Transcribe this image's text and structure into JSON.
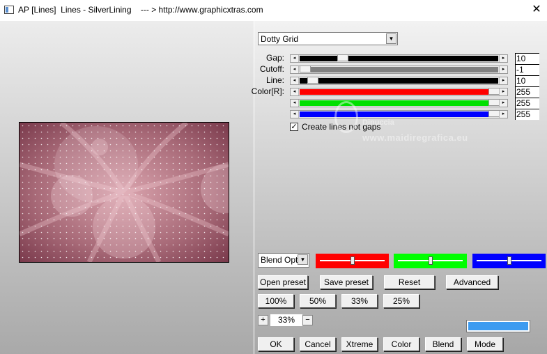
{
  "window": {
    "title": "AP [Lines]  Lines - SilverLining    --- > http://www.graphicxtras.com",
    "close_glyph": "✕"
  },
  "mode_select": {
    "value": "Dotty Grid"
  },
  "sliders": [
    {
      "label": "Gap:",
      "value": "10",
      "track_color": "#000000",
      "position": 0.2
    },
    {
      "label": "Cutoff:",
      "value": "-1",
      "track_color": "#808080",
      "position": 0.0
    },
    {
      "label": "Line:",
      "value": "10",
      "track_color": "#000000",
      "position": 0.04
    },
    {
      "label": "Color[R]:",
      "value": "255",
      "track_color": "#ff0000",
      "position": 1.0
    },
    {
      "label": "",
      "value": "255",
      "track_color": "#00e000",
      "position": 1.0
    },
    {
      "label": "",
      "value": "255",
      "track_color": "#0000ff",
      "position": 1.0
    }
  ],
  "option": {
    "label": "Create lines not gaps",
    "checked": true,
    "check_glyph": "✓"
  },
  "watermark": {
    "line1": "Dinuccia",
    "line2": "www.maidiregrafica.eu"
  },
  "blend_select": {
    "value": "Blend Optio"
  },
  "color_sliders": [
    {
      "color": "#ff0000",
      "position": 0.5
    },
    {
      "color": "#00ff00",
      "position": 0.5
    },
    {
      "color": "#0000ff",
      "position": 0.5
    }
  ],
  "buttons": {
    "open_preset": "Open preset",
    "save_preset": "Save preset",
    "reset": "Reset",
    "advanced": "Advanced",
    "z100": "100%",
    "z50": "50%",
    "z33": "33%",
    "z25": "25%",
    "ok": "OK",
    "cancel": "Cancel",
    "xtreme": "Xtreme",
    "color": "Color",
    "blend": "Blend",
    "mode": "Mode"
  },
  "zoom": {
    "value": "33%",
    "plus": "+",
    "minus": "−"
  },
  "swatch_color": "#3d9bf0"
}
